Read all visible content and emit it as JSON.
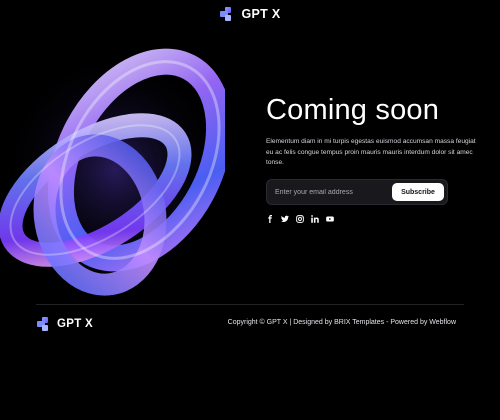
{
  "header": {
    "brand": "GPT X",
    "icon": "stacked-squares-logo-icon"
  },
  "hero": {
    "title": "Coming soon",
    "description": "Elementum diam in mi turpis egestas euismod accumsan massa feugiat eu ac felis congue tempus proin mauris mauris interdum dolor sit amec tonse.",
    "image_icon": "glass-rings-3d-illustration"
  },
  "subscribe": {
    "placeholder": "Enter your email address",
    "button_label": "Subscribe"
  },
  "social": [
    {
      "name": "facebook-icon"
    },
    {
      "name": "twitter-icon"
    },
    {
      "name": "instagram-icon"
    },
    {
      "name": "linkedin-icon"
    },
    {
      "name": "youtube-icon"
    }
  ],
  "footer": {
    "brand": "GPT X",
    "copyright": "Copyright © GPT X | Designed by BRIX Templates - Powered by Webflow"
  },
  "colors": {
    "background": "#000000",
    "accent_blue": "#5b6cff",
    "accent_purple": "#b57cff",
    "button_bg": "#ffffff"
  }
}
